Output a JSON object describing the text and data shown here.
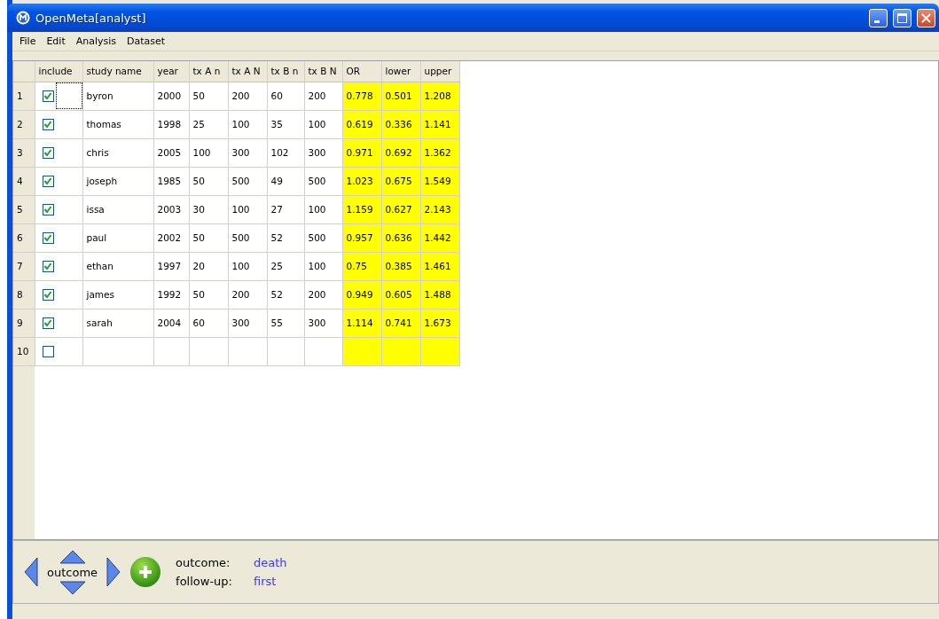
{
  "window": {
    "title": "OpenMeta[analyst]"
  },
  "menu": [
    "File",
    "Edit",
    "Analysis",
    "Dataset"
  ],
  "table": {
    "columns": [
      {
        "label": "include",
        "kind": "check"
      },
      {
        "label": "study name",
        "kind": "input"
      },
      {
        "label": "year",
        "kind": "input"
      },
      {
        "label": "tx A n",
        "kind": "input"
      },
      {
        "label": "tx A N",
        "kind": "input"
      },
      {
        "label": "tx B n",
        "kind": "input"
      },
      {
        "label": "tx B N",
        "kind": "input"
      },
      {
        "label": "OR",
        "kind": "computed"
      },
      {
        "label": "lower",
        "kind": "computed"
      },
      {
        "label": "upper",
        "kind": "computed"
      }
    ],
    "rows": [
      {
        "number": "1",
        "include": true,
        "focused": true,
        "cells": [
          "byron",
          "2000",
          "50",
          "200",
          "60",
          "200",
          "0.778",
          "0.501",
          "1.208"
        ]
      },
      {
        "number": "2",
        "include": true,
        "focused": false,
        "cells": [
          "thomas",
          "1998",
          "25",
          "100",
          "35",
          "100",
          "0.619",
          "0.336",
          "1.141"
        ]
      },
      {
        "number": "3",
        "include": true,
        "focused": false,
        "cells": [
          "chris",
          "2005",
          "100",
          "300",
          "102",
          "300",
          "0.971",
          "0.692",
          "1.362"
        ]
      },
      {
        "number": "4",
        "include": true,
        "focused": false,
        "cells": [
          "joseph",
          "1985",
          "50",
          "500",
          "49",
          "500",
          "1.023",
          "0.675",
          "1.549"
        ]
      },
      {
        "number": "5",
        "include": true,
        "focused": false,
        "cells": [
          "issa",
          "2003",
          "30",
          "100",
          "27",
          "100",
          "1.159",
          "0.627",
          "2.143"
        ]
      },
      {
        "number": "6",
        "include": true,
        "focused": false,
        "cells": [
          "paul",
          "2002",
          "50",
          "500",
          "52",
          "500",
          "0.957",
          "0.636",
          "1.442"
        ]
      },
      {
        "number": "7",
        "include": true,
        "focused": false,
        "cells": [
          "ethan",
          "1997",
          "20",
          "100",
          "25",
          "100",
          "0.75",
          "0.385",
          "1.461"
        ]
      },
      {
        "number": "8",
        "include": true,
        "focused": false,
        "cells": [
          "james",
          "1992",
          "50",
          "200",
          "52",
          "200",
          "0.949",
          "0.605",
          "1.488"
        ]
      },
      {
        "number": "9",
        "include": true,
        "focused": false,
        "cells": [
          "sarah",
          "2004",
          "60",
          "300",
          "55",
          "300",
          "1.114",
          "0.741",
          "1.673"
        ]
      },
      {
        "number": "10",
        "include": false,
        "focused": false
      }
    ]
  },
  "navigator": {
    "label": "outcome"
  },
  "info": [
    {
      "label": "outcome:",
      "value": "death"
    },
    {
      "label": "follow-up:",
      "value": "first"
    }
  ]
}
